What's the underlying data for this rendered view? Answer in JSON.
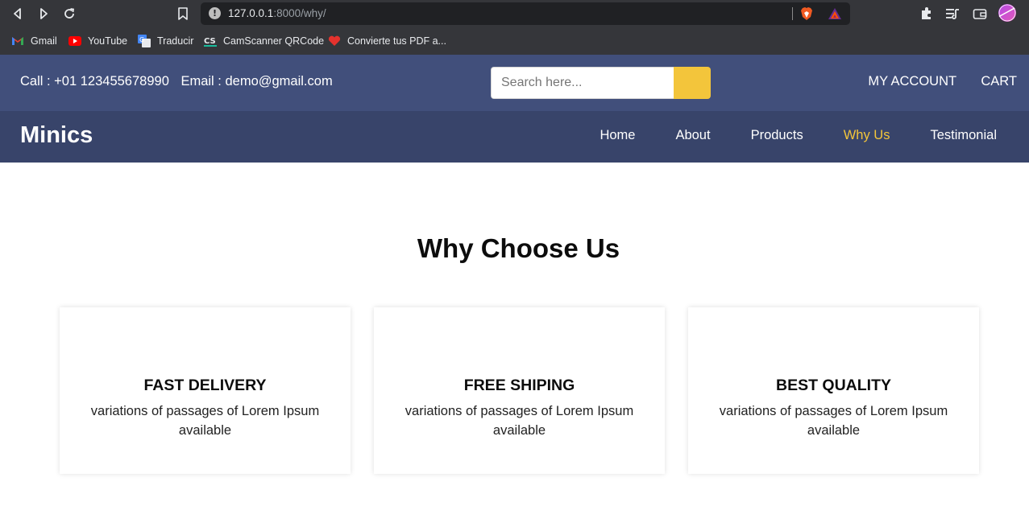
{
  "browser": {
    "address_host": "127.0.0.1",
    "address_path": ":8000/why/",
    "bookmarks": [
      {
        "label": "Gmail",
        "icon": "gmail-icon"
      },
      {
        "label": "YouTube",
        "icon": "youtube-icon"
      },
      {
        "label": "Traducir",
        "icon": "translate-icon"
      },
      {
        "label": "CamScanner QRCode",
        "icon": "camscanner-icon"
      },
      {
        "label": "Convierte tus PDF a...",
        "icon": "heart-pdf-icon"
      }
    ]
  },
  "topbar": {
    "call": "Call : +01 123455678990",
    "email": "Email : demo@gmail.com",
    "search_placeholder": "Search here...",
    "my_account": "MY ACCOUNT",
    "cart": "CART"
  },
  "nav": {
    "brand": "Minics",
    "items": [
      {
        "label": "Home",
        "active": false
      },
      {
        "label": "About",
        "active": false
      },
      {
        "label": "Products",
        "active": false
      },
      {
        "label": "Why Us",
        "active": true
      },
      {
        "label": "Testimonial",
        "active": false
      }
    ]
  },
  "main": {
    "heading": "Why Choose Us",
    "cards": [
      {
        "title": "FAST DELIVERY",
        "text": "variations of passages of Lorem Ipsum available"
      },
      {
        "title": "FREE SHIPING",
        "text": "variations of passages of Lorem Ipsum available"
      },
      {
        "title": "BEST QUALITY",
        "text": "variations of passages of Lorem Ipsum available"
      }
    ]
  },
  "colors": {
    "topbar_bg": "#414f7b",
    "nav_bg": "#38446a",
    "accent": "#f3c53b"
  }
}
